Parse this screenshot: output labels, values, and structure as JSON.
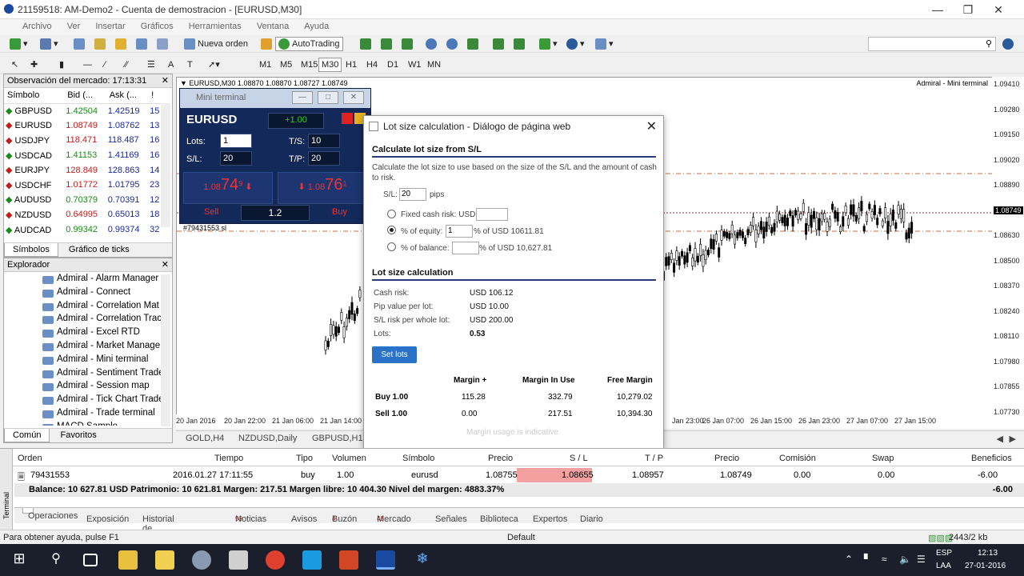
{
  "window": {
    "title": "21159518: AM-Demo2 - Cuenta de demostracion - [EURUSD,M30]"
  },
  "menu": [
    "Archivo",
    "Ver",
    "Insertar",
    "Gráficos",
    "Herramientas",
    "Ventana",
    "Ayuda"
  ],
  "toolbar": {
    "new_order": "Nueva orden",
    "autotrading": "AutoTrading",
    "timeframes": [
      "M1",
      "M5",
      "M15",
      "M30",
      "H1",
      "H4",
      "D1",
      "W1",
      "MN"
    ]
  },
  "market_watch": {
    "title": "Observación del mercado: 17:13:31",
    "headers": [
      "Símbolo",
      "Bid (...",
      "Ask (...",
      "!"
    ],
    "rows": [
      {
        "sym": "GBPUSD",
        "bid": "1.42504",
        "ask": "1.42519",
        "sp": "15",
        "dir": "up"
      },
      {
        "sym": "EURUSD",
        "bid": "1.08749",
        "ask": "1.08762",
        "sp": "13",
        "dir": "dn"
      },
      {
        "sym": "USDJPY",
        "bid": "118.471",
        "ask": "118.487",
        "sp": "16",
        "dir": "dn"
      },
      {
        "sym": "USDCAD",
        "bid": "1.41153",
        "ask": "1.41169",
        "sp": "16",
        "dir": "up"
      },
      {
        "sym": "EURJPY",
        "bid": "128.849",
        "ask": "128.863",
        "sp": "14",
        "dir": "dn"
      },
      {
        "sym": "USDCHF",
        "bid": "1.01772",
        "ask": "1.01795",
        "sp": "23",
        "dir": "dn"
      },
      {
        "sym": "AUDUSD",
        "bid": "0.70379",
        "ask": "0.70391",
        "sp": "12",
        "dir": "up"
      },
      {
        "sym": "NZDUSD",
        "bid": "0.64995",
        "ask": "0.65013",
        "sp": "18",
        "dir": "dn"
      },
      {
        "sym": "AUDCAD",
        "bid": "0.99342",
        "ask": "0.99374",
        "sp": "32",
        "dir": "up"
      }
    ],
    "tabs": [
      "Símbolos",
      "Gráfico de ticks"
    ]
  },
  "navigator": {
    "title": "Explorador",
    "items": [
      "Admiral - Alarm Manager",
      "Admiral - Connect",
      "Admiral - Correlation Mat",
      "Admiral - Correlation Trac",
      "Admiral - Excel RTD",
      "Admiral - Market Manage",
      "Admiral - Mini terminal",
      "Admiral - Sentiment Trade",
      "Admiral - Session map",
      "Admiral - Tick Chart Trade",
      "Admiral - Trade terminal",
      "MACD Sample"
    ],
    "tabs": [
      "Común",
      "Favoritos"
    ]
  },
  "chart": {
    "header": "EURUSD,M30  1.08870 1.08870 1.08727 1.08749",
    "indicator": "Admiral - Mini terminal",
    "order_label": "#79431553 sl",
    "price_axis": [
      "1.09410",
      "1.09280",
      "1.09150",
      "1.09020",
      "1.08890",
      "1.08749",
      "1.08630",
      "1.08500",
      "1.08370",
      "1.08240",
      "1.08110",
      "1.07980",
      "1.07855",
      "1.07730"
    ],
    "time_axis": [
      "20 Jan 2016",
      "20 Jan 22:00",
      "21 Jan 06:00",
      "21 Jan 14:00",
      "Jan 23:00",
      "26 Jan 07:00",
      "26 Jan 15:00",
      "26 Jan 23:00",
      "27 Jan 07:00",
      "27 Jan 15:00"
    ],
    "tabs": [
      "GOLD,H4",
      "NZDUSD,Daily",
      "GBPUSD,H1"
    ]
  },
  "mini_terminal": {
    "title": "Mini terminal",
    "symbol": "EURUSD",
    "change": "+1.00",
    "lots_label": "Lots:",
    "lots": "1",
    "sl_label": "S/L:",
    "sl": "20",
    "ts_label": "T/S:",
    "ts": "10",
    "tp_label": "T/P:",
    "tp": "20",
    "sell_price_small": "1.08",
    "sell_price_big": "74",
    "sell_sup": "9",
    "buy_price_small": "1.08",
    "buy_price_big": "76",
    "buy_sup": "1",
    "sell_label": "Sell",
    "buy_label": "Buy",
    "spread": "1.2"
  },
  "dialog": {
    "title": "Lot size calculation - Diálogo de página web",
    "section1": "Calculate lot size from S/L",
    "desc": "Calculate the lot size to use based on the size of the S/L and the amount of cash to risk.",
    "sl_label": "S/L:",
    "sl_value": "20",
    "sl_unit": "pips",
    "opt_fixed": "Fixed cash risk: USD",
    "opt_equity": "% of equity:",
    "equity_value": "1",
    "equity_suffix": "% of USD 10611.81",
    "opt_balance": "% of balance:",
    "balance_suffix": "% of USD 10,627.81",
    "section2": "Lot size calculation",
    "calc": [
      {
        "label": "Cash risk:",
        "value": "USD 106.12"
      },
      {
        "label": "Pip value per lot:",
        "value": "USD 10.00"
      },
      {
        "label": "S/L risk per whole lot:",
        "value": "USD 200.00"
      },
      {
        "label": "Lots:",
        "value": "0.53"
      }
    ],
    "set_lots": "Set lots",
    "margin_headers": [
      "Margin +",
      "Margin In Use",
      "Free Margin"
    ],
    "margin_rows": [
      {
        "label": "Buy 1.00",
        "m": "115.28",
        "use": "332.79",
        "free": "10,279.02"
      },
      {
        "label": "Sell 1.00",
        "m": "0.00",
        "use": "217.51",
        "free": "10,394.30"
      }
    ],
    "footnote": "Margin usage is indicative"
  },
  "terminal": {
    "headers": [
      "Orden",
      "Tiempo",
      "Tipo",
      "Volumen",
      "Símbolo",
      "Precio",
      "S / L",
      "T / P",
      "Precio",
      "Comisión",
      "Swap",
      "Beneficios"
    ],
    "row": [
      "79431553",
      "2016.01.27 17:11:55",
      "buy",
      "1.00",
      "eurusd",
      "1.08755",
      "1.08655",
      "1.08957",
      "1.08749",
      "0.00",
      "0.00",
      "-6.00"
    ],
    "balance": "Balance: 10 627.81 USD  Patrimonio: 10 621.81  Margen: 217.51  Margen libre: 10 404.30  Nivel del margen: 4883.37%",
    "balance_profit": "-6.00",
    "tabs": [
      "Operaciones",
      "Exposición",
      "Historial de cuentas",
      "Noticias",
      "Avisos",
      "Buzón",
      "Mercado",
      "Señales",
      "Biblioteca",
      "Expertos",
      "Diario"
    ],
    "tab_badges": {
      "news": "99",
      "mail": "4",
      "market": "48"
    },
    "side_label": "Terminal"
  },
  "status": {
    "help": "Para obtener ayuda, pulse F1",
    "profile": "Default",
    "traffic": "2443/2 kb"
  },
  "taskbar": {
    "lang": "ESP",
    "lang2": "LAA",
    "time": "12:13",
    "date": "27-01-2016"
  }
}
